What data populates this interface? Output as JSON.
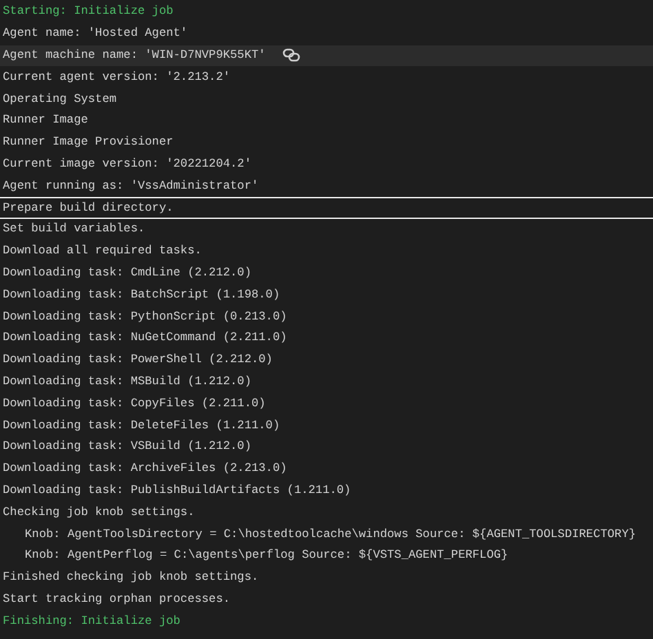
{
  "log_lines": [
    {
      "kind": "section",
      "text": "Starting: Initialize job",
      "highlighted": false,
      "selected": false
    },
    {
      "kind": "plain",
      "text": "Agent name: 'Hosted Agent'",
      "highlighted": false,
      "selected": false
    },
    {
      "kind": "plain",
      "text": "Agent machine name: 'WIN-D7NVP9K55KT'",
      "highlighted": true,
      "selected": false
    },
    {
      "kind": "plain",
      "text": "Current agent version: '2.213.2'",
      "highlighted": false,
      "selected": false
    },
    {
      "kind": "plain",
      "text": "Operating System",
      "highlighted": false,
      "selected": false
    },
    {
      "kind": "plain",
      "text": "Runner Image",
      "highlighted": false,
      "selected": false
    },
    {
      "kind": "plain",
      "text": "Runner Image Provisioner",
      "highlighted": false,
      "selected": false
    },
    {
      "kind": "plain",
      "text": "Current image version: '20221204.2'",
      "highlighted": false,
      "selected": false
    },
    {
      "kind": "plain",
      "text": "Agent running as: 'VssAdministrator'",
      "highlighted": false,
      "selected": false
    },
    {
      "kind": "plain",
      "text": "Prepare build directory.",
      "highlighted": false,
      "selected": true
    },
    {
      "kind": "plain",
      "text": "Set build variables.",
      "highlighted": false,
      "selected": false
    },
    {
      "kind": "plain",
      "text": "Download all required tasks.",
      "highlighted": false,
      "selected": false
    },
    {
      "kind": "plain",
      "text": "Downloading task: CmdLine (2.212.0)",
      "highlighted": false,
      "selected": false
    },
    {
      "kind": "plain",
      "text": "Downloading task: BatchScript (1.198.0)",
      "highlighted": false,
      "selected": false
    },
    {
      "kind": "plain",
      "text": "Downloading task: PythonScript (0.213.0)",
      "highlighted": false,
      "selected": false
    },
    {
      "kind": "plain",
      "text": "Downloading task: NuGetCommand (2.211.0)",
      "highlighted": false,
      "selected": false
    },
    {
      "kind": "plain",
      "text": "Downloading task: PowerShell (2.212.0)",
      "highlighted": false,
      "selected": false
    },
    {
      "kind": "plain",
      "text": "Downloading task: MSBuild (1.212.0)",
      "highlighted": false,
      "selected": false
    },
    {
      "kind": "plain",
      "text": "Downloading task: CopyFiles (2.211.0)",
      "highlighted": false,
      "selected": false
    },
    {
      "kind": "plain",
      "text": "Downloading task: DeleteFiles (1.211.0)",
      "highlighted": false,
      "selected": false
    },
    {
      "kind": "plain",
      "text": "Downloading task: VSBuild (1.212.0)",
      "highlighted": false,
      "selected": false
    },
    {
      "kind": "plain",
      "text": "Downloading task: ArchiveFiles (2.213.0)",
      "highlighted": false,
      "selected": false
    },
    {
      "kind": "plain",
      "text": "Downloading task: PublishBuildArtifacts (1.211.0)",
      "highlighted": false,
      "selected": false
    },
    {
      "kind": "plain",
      "text": "Checking job knob settings.",
      "highlighted": false,
      "selected": false
    },
    {
      "kind": "indented",
      "text": "Knob: AgentToolsDirectory = C:\\hostedtoolcache\\windows Source: ${AGENT_TOOLSDIRECTORY}",
      "highlighted": false,
      "selected": false
    },
    {
      "kind": "indented",
      "text": "Knob: AgentPerflog = C:\\agents\\perflog Source: ${VSTS_AGENT_PERFLOG}",
      "highlighted": false,
      "selected": false
    },
    {
      "kind": "plain",
      "text": "Finished checking job knob settings.",
      "highlighted": false,
      "selected": false
    },
    {
      "kind": "plain",
      "text": "Start tracking orphan processes.",
      "highlighted": false,
      "selected": false
    },
    {
      "kind": "section",
      "text": "Finishing: Initialize job",
      "highlighted": false,
      "selected": false
    }
  ]
}
